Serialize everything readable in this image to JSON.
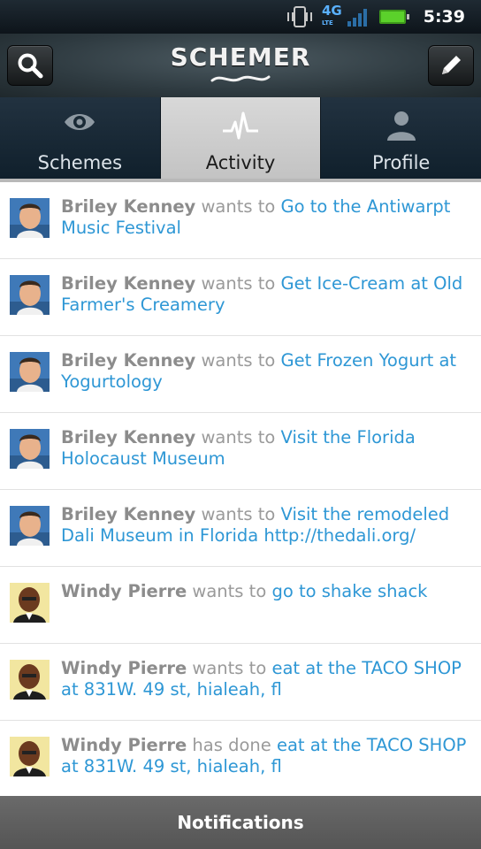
{
  "status_bar": {
    "network": "4G",
    "network_sub": "LTE",
    "time": "5:39",
    "icons": [
      "vibrate-icon",
      "network-4g-lte-icon",
      "signal-icon",
      "battery-icon"
    ]
  },
  "header": {
    "title": "SCHEMER",
    "search_icon": "search-icon",
    "compose_icon": "pencil-icon"
  },
  "tabs": [
    {
      "label": "Schemes",
      "icon": "eye-icon",
      "active": false
    },
    {
      "label": "Activity",
      "icon": "pulse-icon",
      "active": true
    },
    {
      "label": "Profile",
      "icon": "person-icon",
      "active": false
    }
  ],
  "activity": [
    {
      "name": "Briley Kenney",
      "verb": "wants to",
      "link": "Go to the Antiwarpt Music Festival",
      "avatar": "photo"
    },
    {
      "name": "Briley Kenney",
      "verb": "wants to",
      "link": "Get Ice-Cream at Old Farmer's Creamery",
      "avatar": "photo"
    },
    {
      "name": "Briley Kenney",
      "verb": "wants to",
      "link": "Get Frozen Yogurt at Yogurtology",
      "avatar": "photo"
    },
    {
      "name": "Briley Kenney",
      "verb": "wants to",
      "link": "Visit the Florida Holocaust Museum",
      "avatar": "photo"
    },
    {
      "name": "Briley Kenney",
      "verb": "wants to",
      "link": "Visit the remodeled Dali Museum in Florida http://thedali.org/",
      "avatar": "photo"
    },
    {
      "name": "Windy Pierre",
      "verb": "wants to",
      "link": "go to shake shack",
      "avatar": "cartoon"
    },
    {
      "name": "Windy Pierre",
      "verb": "wants to",
      "link": "eat at the TACO SHOP at 831W. 49 st, hialeah, fl",
      "avatar": "cartoon"
    },
    {
      "name": "Windy Pierre",
      "verb": "has done",
      "link": "eat at the TACO SHOP at 831W. 49 st, hialeah, fl",
      "avatar": "cartoon"
    }
  ],
  "notifications": {
    "label": "Notifications"
  },
  "colors": {
    "link": "#2e97d5",
    "name": "#8c8c8c",
    "verb": "#9a9a9a",
    "accent": "#5ab1ff"
  }
}
